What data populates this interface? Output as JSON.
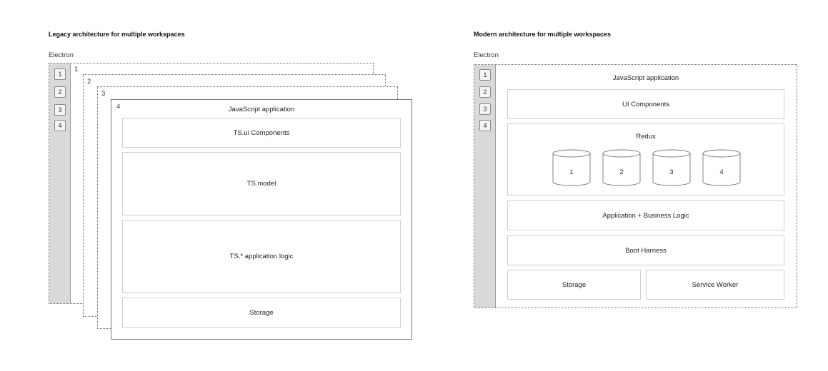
{
  "legacy": {
    "title": "Legacy architecture for multiple workspaces",
    "electron_label": "Electron",
    "sidebar_buttons": [
      "1",
      "2",
      "3",
      "4"
    ],
    "layer_numbers": [
      "1",
      "2",
      "3",
      "4"
    ],
    "app_title": "JavaScript application",
    "layers": [
      "TS.ui Components",
      "TS.model",
      "TS.* application logic",
      "Storage"
    ]
  },
  "modern": {
    "title": "Modern architecture for multiple workspaces",
    "electron_label": "Electron",
    "sidebar_buttons": [
      "1",
      "2",
      "3",
      "4"
    ],
    "app_title": "JavaScript application",
    "ui_components": "UI Components",
    "redux_title": "Redux",
    "stores": [
      "1",
      "2",
      "3",
      "4"
    ],
    "app_logic": "Application + Business Logic",
    "boot_harness": "Boot Harness",
    "storage": "Storage",
    "service_worker": "Service Worker"
  }
}
